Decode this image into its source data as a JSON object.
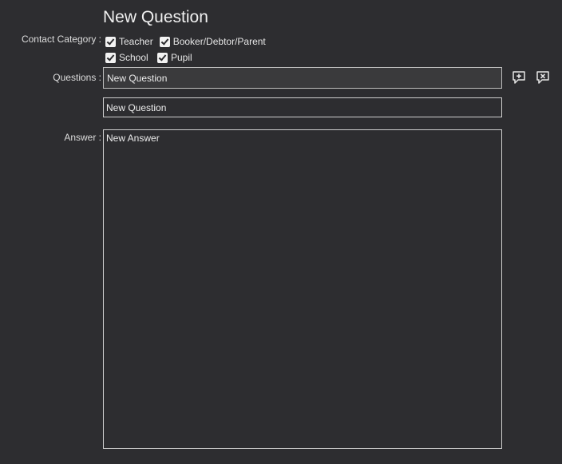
{
  "form": {
    "title": "New Question",
    "contact_category_label": "Contact Category :",
    "categories": [
      {
        "label": "Teacher",
        "checked": true
      },
      {
        "label": "Booker/Debtor/Parent",
        "checked": true
      },
      {
        "label": "School",
        "checked": true
      },
      {
        "label": "Pupil",
        "checked": true
      }
    ],
    "questions_label": "Questions :",
    "questions": [
      "New Question",
      "New Question"
    ],
    "answer_label": "Answer :",
    "answer": "New Answer"
  },
  "icons": {
    "add_question": "speech-bubble-plus-icon",
    "remove_question": "speech-bubble-x-icon"
  },
  "colors": {
    "background": "#2d2d30",
    "text": "#e6e6e6",
    "field_border": "#cfcfcf"
  }
}
